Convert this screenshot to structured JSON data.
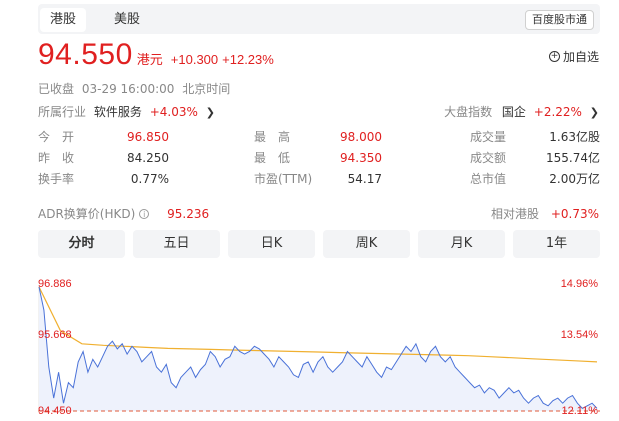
{
  "tabs": {
    "hk": "港股",
    "us": "美股",
    "connect": "百度股市通"
  },
  "quote": {
    "price": "94.550",
    "currency": "港元",
    "change": "+10.300",
    "change_pct": "+12.23%",
    "watch_label": "加自选"
  },
  "status": {
    "state": "已收盘",
    "time": "03-29 16:00:00",
    "tz": "北京时间"
  },
  "industry": {
    "label": "所属行业",
    "name": "软件服务",
    "change": "+4.03%"
  },
  "index": {
    "label": "大盘指数",
    "name": "国企",
    "change": "+2.22%"
  },
  "stats": {
    "open": {
      "label": "今　开",
      "value": "96.850"
    },
    "high": {
      "label": "最　高",
      "value": "98.000"
    },
    "volume": {
      "label": "成交量",
      "value": "1.63亿股"
    },
    "prev_close": {
      "label": "昨　收",
      "value": "84.250"
    },
    "low": {
      "label": "最　低",
      "value": "94.350"
    },
    "turnover": {
      "label": "成交额",
      "value": "155.74亿"
    },
    "turnover_rate": {
      "label": "换手率",
      "value": "0.77%"
    },
    "pe": {
      "label": "市盈(TTM)",
      "value": "54.17"
    },
    "market_cap": {
      "label": "总市值",
      "value": "2.00万亿"
    }
  },
  "adr": {
    "label": "ADR换算价(HKD)",
    "value": "95.236",
    "rel_label": "相对港股",
    "rel_value": "+0.73%"
  },
  "periods": [
    "分时",
    "五日",
    "日K",
    "周K",
    "月K",
    "1年"
  ],
  "chart_levels": {
    "top_price": "96.886",
    "mid_price": "95.668",
    "low_price": "94.450",
    "top_pct": "14.96%",
    "mid_pct": "13.54%",
    "low_pct": "12.11%"
  },
  "colors": {
    "up": "#e02020",
    "down": "#19a15f",
    "price_line": "#4a72d8",
    "avg_line": "#f0b030",
    "fill": "#eef2fc"
  },
  "chart_data": {
    "type": "line",
    "title": "",
    "xlabel": "",
    "ylabel": "",
    "ylim": [
      94.45,
      96.886
    ],
    "series": [
      {
        "values": [
          96.85,
          96.4,
          95.3,
          94.7,
          95.2,
          94.6,
          95.0,
          94.9,
          95.4,
          95.6,
          95.2,
          95.45,
          95.3,
          95.5,
          95.7,
          95.8,
          95.65,
          95.75,
          95.55,
          95.7,
          95.6,
          95.4,
          95.5,
          95.6,
          95.3,
          95.2,
          95.35,
          95.0,
          94.9,
          95.1,
          95.2,
          95.3,
          95.1,
          95.25,
          95.35,
          95.6,
          95.5,
          95.3,
          95.45,
          95.5,
          95.7,
          95.6,
          95.55,
          95.6,
          95.7,
          95.65,
          95.55,
          95.45,
          95.3,
          95.5,
          95.4,
          95.3,
          95.15,
          95.1,
          95.35,
          95.4,
          95.2,
          95.4,
          95.5,
          95.3,
          95.2,
          95.3,
          95.4,
          95.6,
          95.5,
          95.4,
          95.3,
          95.5,
          95.35,
          95.2,
          95.1,
          95.3,
          95.25,
          95.4,
          95.55,
          95.7,
          95.6,
          95.75,
          95.5,
          95.4,
          95.6,
          95.7,
          95.5,
          95.4,
          95.5,
          95.3,
          95.2,
          95.1,
          95.0,
          94.9,
          94.95,
          94.8,
          94.9,
          94.85,
          94.7,
          94.8,
          94.9,
          94.8,
          94.85,
          94.7,
          94.6,
          94.7,
          94.75,
          94.6,
          94.55,
          94.65,
          94.7,
          94.6,
          94.7,
          94.75,
          94.6,
          94.5,
          94.55,
          94.6,
          94.5
        ]
      },
      {
        "values": [
          96.85,
          96.0,
          95.75,
          95.72,
          95.7,
          95.68,
          95.66,
          95.65,
          95.64,
          95.63,
          95.62,
          95.61,
          95.6,
          95.59,
          95.58,
          95.57,
          95.56,
          95.55,
          95.54,
          95.53,
          95.52,
          95.5,
          95.48,
          95.46,
          95.44,
          95.42,
          95.4
        ]
      }
    ]
  }
}
